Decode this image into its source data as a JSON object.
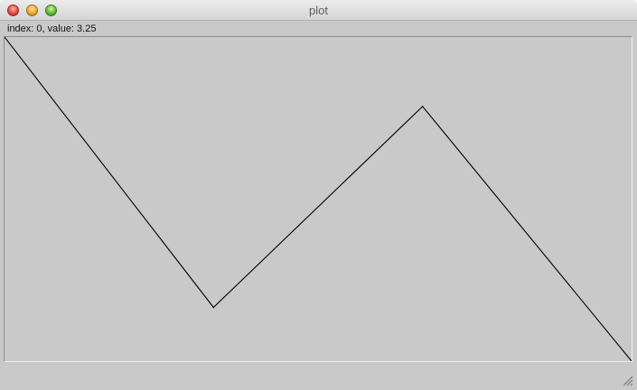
{
  "window": {
    "title": "plot",
    "status_text": "index: 0, value: 3.25"
  },
  "colors": {
    "background": "#c9c9c9",
    "line": "#000000"
  },
  "chart_data": {
    "type": "line",
    "x": [
      0,
      1,
      2,
      3
    ],
    "values": [
      3.25,
      0.33,
      2.5,
      -0.25
    ],
    "ylim": [
      -0.25,
      3.25
    ],
    "grid": false
  }
}
